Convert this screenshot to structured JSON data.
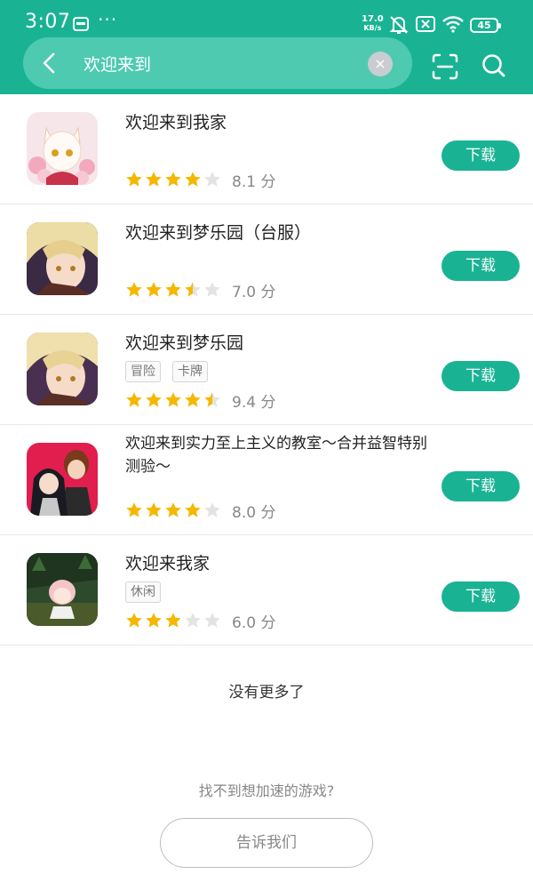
{
  "status_bar": {
    "time": "3:07",
    "dots": "···",
    "net_speed_value": "17.0",
    "net_speed_unit": "KB/s",
    "battery": "45"
  },
  "search": {
    "query": "欢迎来到",
    "clear_symbol": "×"
  },
  "colors": {
    "accent": "#19b394",
    "star_on": "#f5b700",
    "star_off": "#e3e3e3"
  },
  "results": [
    {
      "name": "欢迎来到我家",
      "tags": [],
      "rating": 4,
      "score_text": "8.1 分",
      "download_label": "下载"
    },
    {
      "name": "欢迎来到梦乐园（台服）",
      "tags": [],
      "rating": 3.5,
      "score_text": "7.0 分",
      "download_label": "下载"
    },
    {
      "name": "欢迎来到梦乐园",
      "tags": [
        "冒险",
        "卡牌"
      ],
      "rating": 4.5,
      "score_text": "9.4 分",
      "download_label": "下载"
    },
    {
      "name": "欢迎来到实力至上主义的教室～合并益智特别测验～",
      "tags": [],
      "rating": 4,
      "score_text": "8.0 分",
      "download_label": "下载"
    },
    {
      "name": "欢迎来我家",
      "tags": [
        "休闲"
      ],
      "rating": 3,
      "score_text": "6.0 分",
      "download_label": "下载"
    }
  ],
  "footer": {
    "no_more": "没有更多了",
    "cant_find": "找不到想加速的游戏?",
    "tell_us": "告诉我们"
  }
}
